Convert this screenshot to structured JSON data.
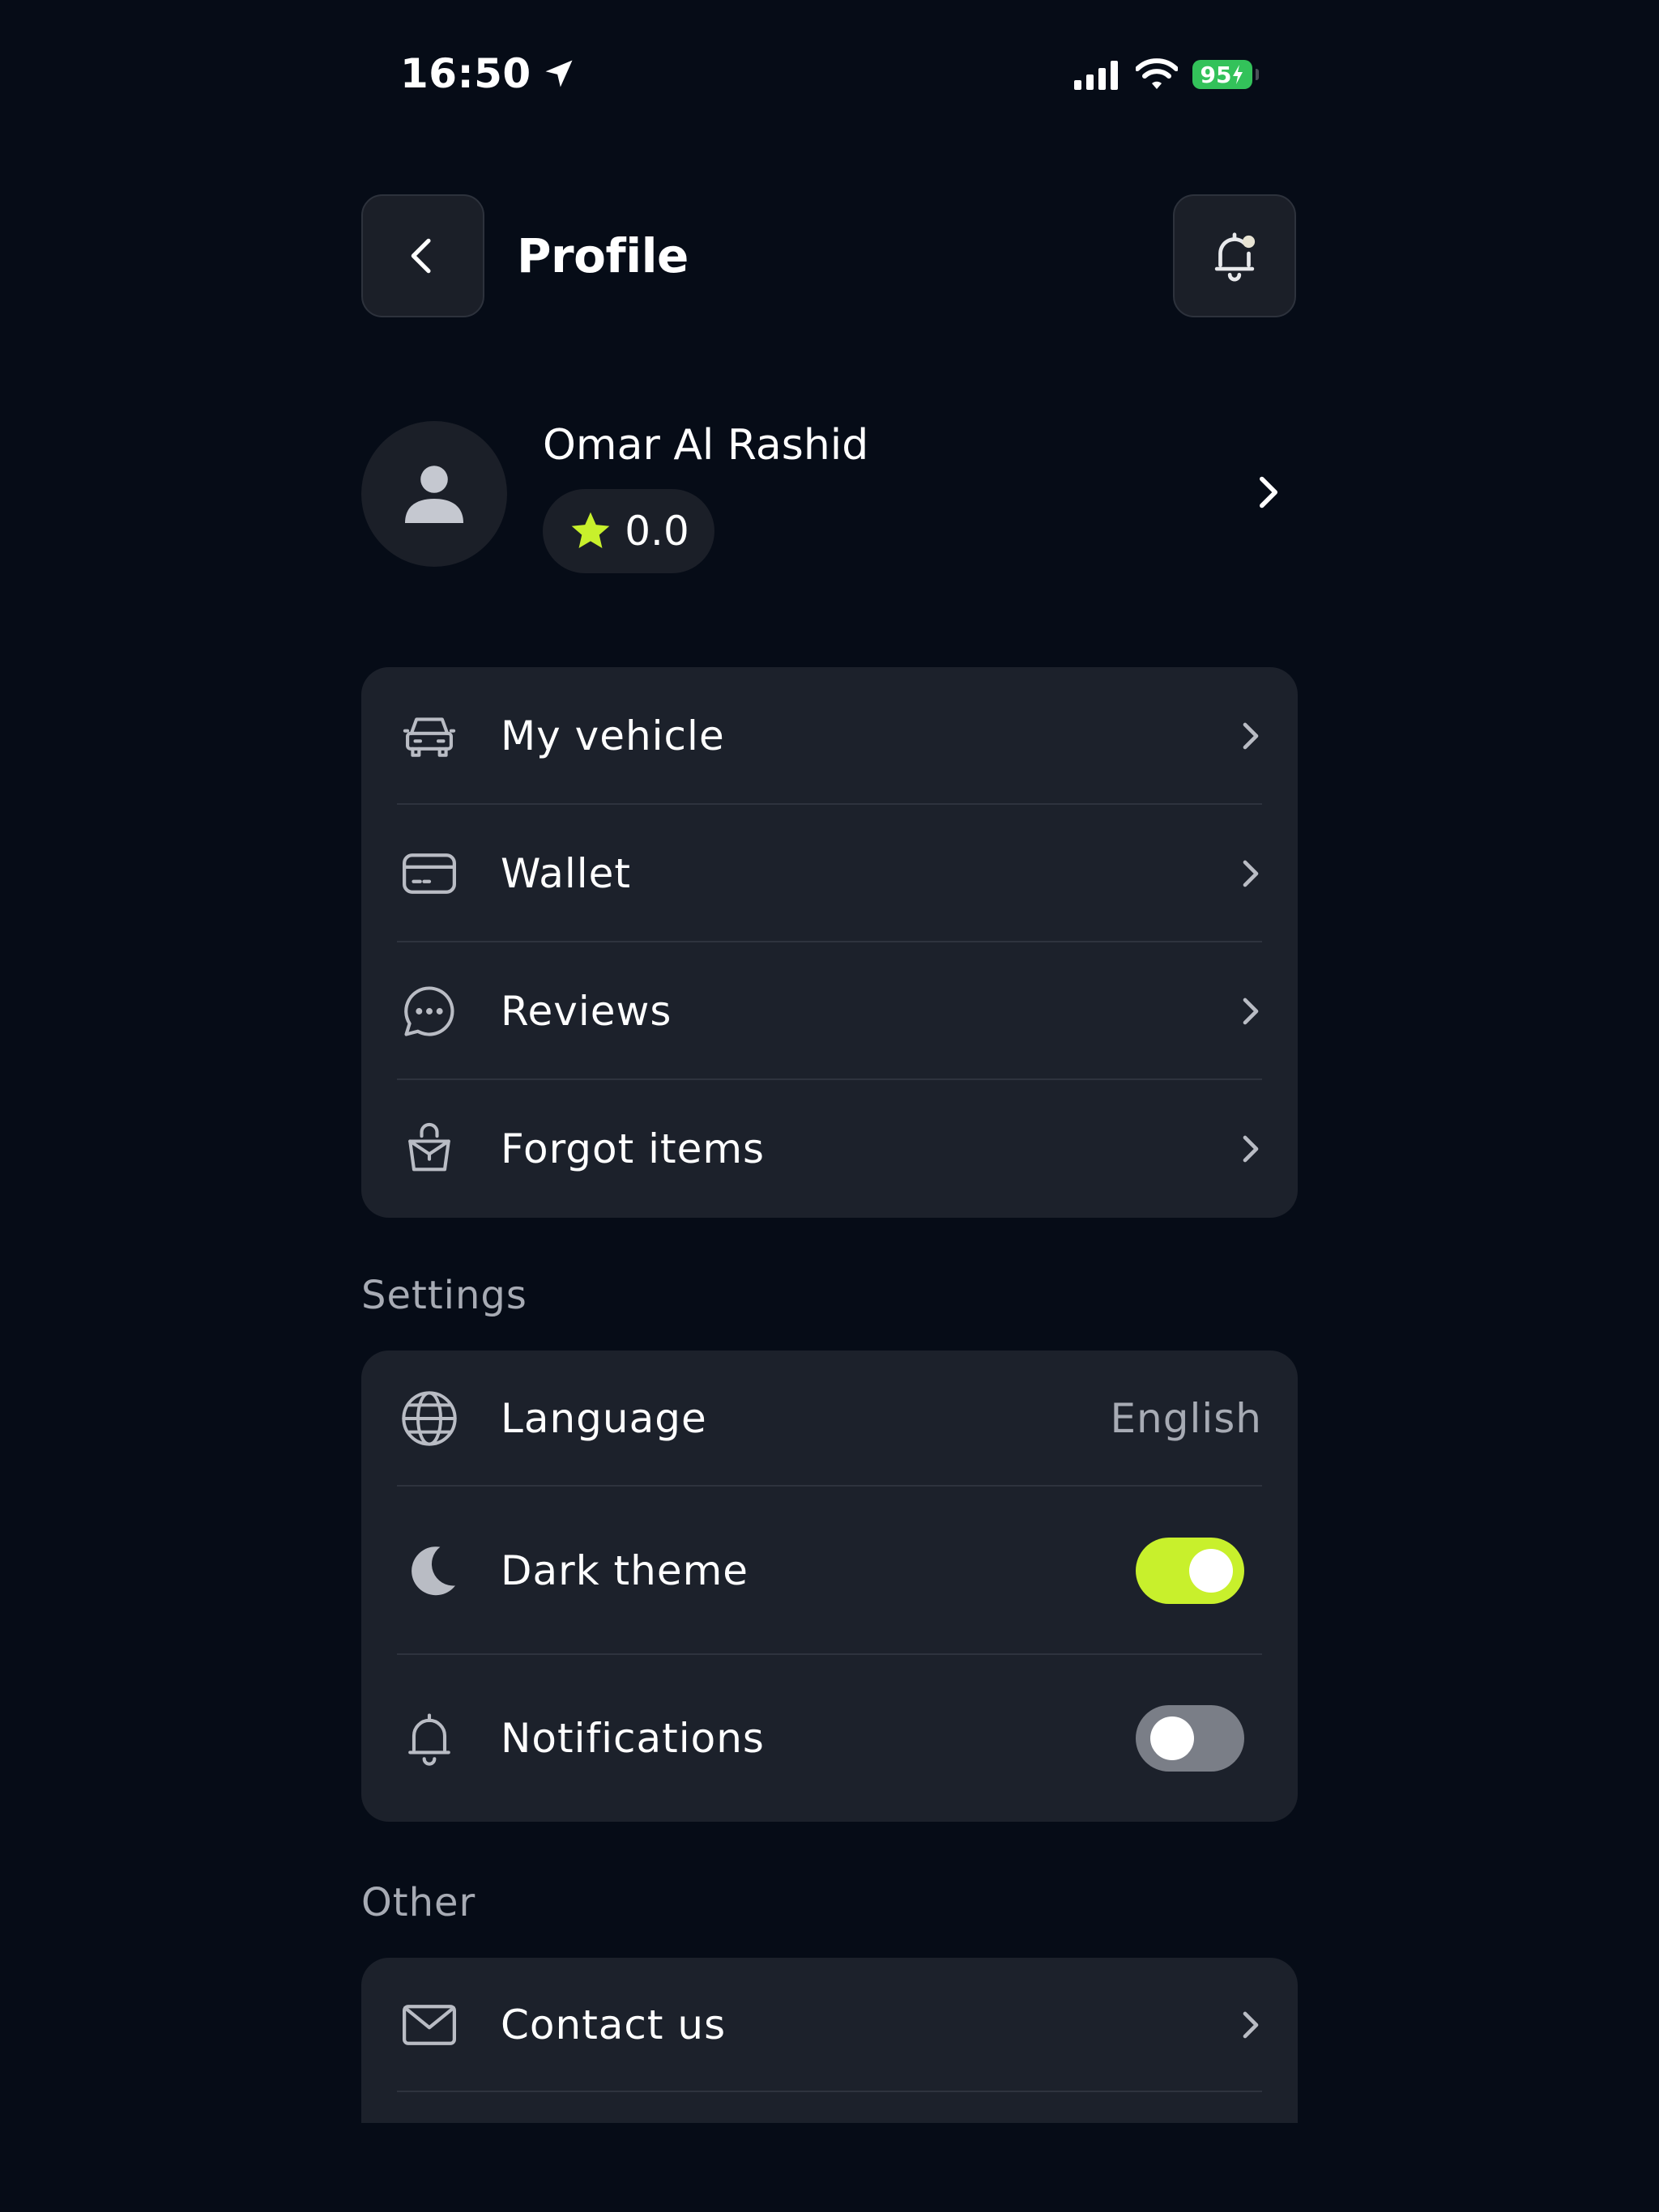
{
  "status_bar": {
    "time": "16:50",
    "battery": "95"
  },
  "header": {
    "title": "Profile"
  },
  "profile": {
    "name": "Omar Al Rashid",
    "rating": "0.0"
  },
  "menu": {
    "items": [
      {
        "label": "My vehicle",
        "icon": "car-icon"
      },
      {
        "label": "Wallet",
        "icon": "card-icon"
      },
      {
        "label": "Reviews",
        "icon": "chat-icon"
      },
      {
        "label": "Forgot items",
        "icon": "bag-icon"
      }
    ]
  },
  "settings": {
    "section_label": "Settings",
    "language": {
      "label": "Language",
      "value": "English"
    },
    "dark_theme": {
      "label": "Dark theme",
      "enabled": true
    },
    "notifications": {
      "label": "Notifications",
      "enabled": false
    }
  },
  "other": {
    "section_label": "Other",
    "items": [
      {
        "label": "Contact us",
        "icon": "mail-icon"
      }
    ]
  },
  "colors": {
    "background": "#060c17",
    "card": "#1c212b",
    "accent": "#c8f02c",
    "battery": "#33c25a"
  }
}
